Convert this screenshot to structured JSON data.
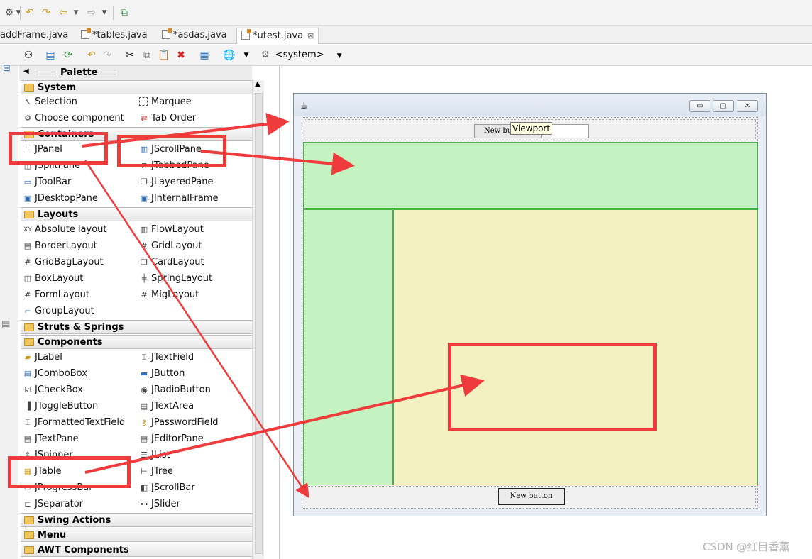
{
  "top_toolbar": {
    "icons": [
      "tool-icon",
      "back-icon",
      "forward-icon",
      "nav-back-icon",
      "nav-forward-icon",
      "open-perspective-icon"
    ]
  },
  "editor_tabs": [
    {
      "label": "addFrame.java",
      "active": false
    },
    {
      "label": "*tables.java",
      "active": false
    },
    {
      "label": "*asdas.java",
      "active": false
    },
    {
      "label": "*utest.java",
      "active": true
    }
  ],
  "designer_toolbar": {
    "system_label": "<system>"
  },
  "palette": {
    "title": "Palette",
    "categories": {
      "system": "System",
      "containers": "Containers",
      "layouts": "Layouts",
      "struts": "Struts & Springs",
      "components": "Components",
      "swing_actions": "Swing Actions",
      "menu": "Menu",
      "awt": "AWT Components"
    },
    "system_items": [
      "Selection",
      "Marquee",
      "Choose component",
      "Tab Order"
    ],
    "container_items": [
      "JPanel",
      "JScrollPane",
      "JSplitPane",
      "JTabbedPane",
      "JToolBar",
      "JLayeredPane",
      "JDesktopPane",
      "JInternalFrame"
    ],
    "layout_items": [
      "Absolute layout",
      "FlowLayout",
      "BorderLayout",
      "GridLayout",
      "GridBagLayout",
      "CardLayout",
      "BoxLayout",
      "SpringLayout",
      "FormLayout",
      "MigLayout",
      "GroupLayout"
    ],
    "component_items": [
      "JLabel",
      "JTextField",
      "JComboBox",
      "JButton",
      "JCheckBox",
      "JRadioButton",
      "JToggleButton",
      "JTextArea",
      "JFormattedTextField",
      "JPasswordField",
      "JTextPane",
      "JEditorPane",
      "JSpinner",
      "JList",
      "JTable",
      "JTree",
      "JProgressBar",
      "JScrollBar",
      "JSeparator",
      "JSlider"
    ]
  },
  "design_canvas": {
    "north_button": "New button",
    "tooltip": "Viewport",
    "south_button": "New button",
    "colors": {
      "green_panel": "#c4f2c1",
      "yellow_panel": "#f3f1c2",
      "annotation_red": "#ef3b3b"
    }
  },
  "watermark": "CSDN @红目香薰"
}
